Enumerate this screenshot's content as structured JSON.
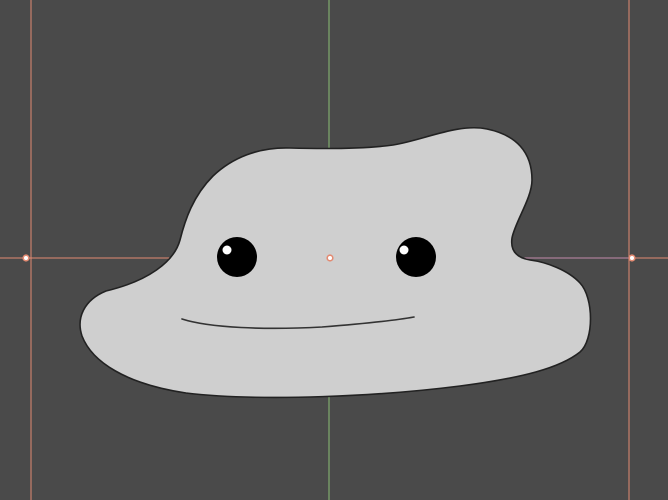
{
  "viewport": {
    "background": "#4a4a4a",
    "guide_color_primary": "#e38b73",
    "guide_color_vertical_center": "#8bbf74",
    "guide_color_horizontal_tint": "#b48cc0",
    "guide_point_fill": "#ffffff"
  },
  "character": {
    "body_fill": "#cfcfcf",
    "body_stroke": "#222222",
    "eye_fill": "#000000",
    "eye_highlight": "#ffffff",
    "mouth_stroke": "#333333"
  },
  "icons": {
    "guide_point": "circle-handle-icon",
    "body": "blob-shape-icon",
    "eye": "eye-icon",
    "mouth": "mouth-line-icon"
  }
}
